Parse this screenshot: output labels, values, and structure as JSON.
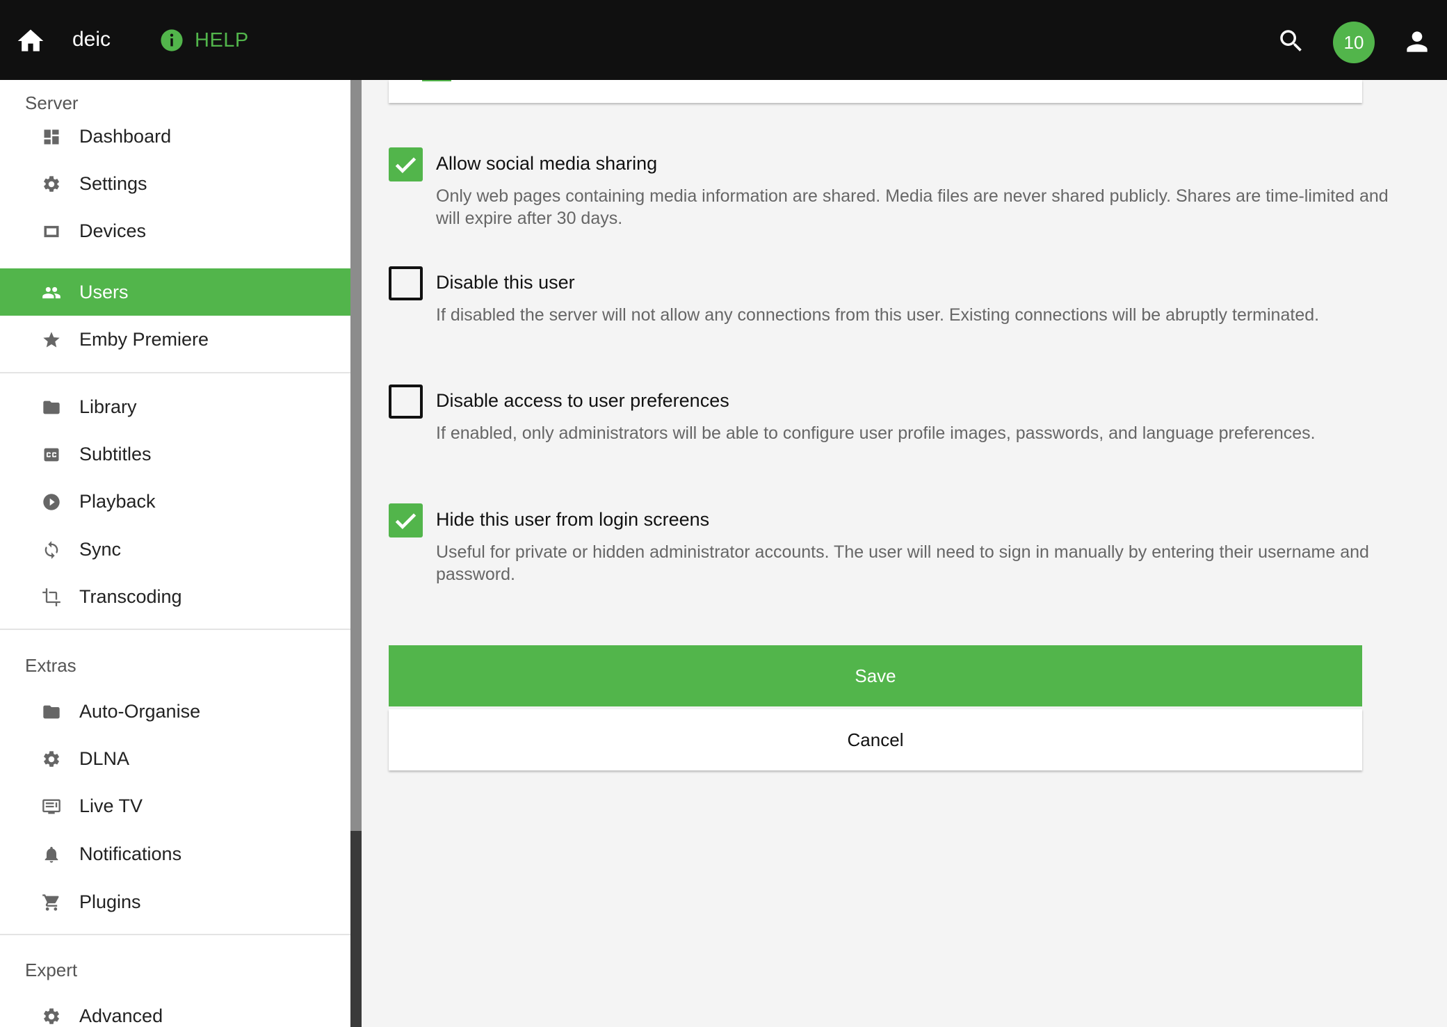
{
  "header": {
    "app_name": "deic",
    "help_label": "HELP",
    "notification_count": "10",
    "icons": [
      "home-icon",
      "info-icon",
      "search-icon",
      "account-icon"
    ]
  },
  "sidebar": {
    "sections": [
      {
        "title": "Server"
      },
      {
        "title": "Extras"
      },
      {
        "title": "Expert"
      }
    ],
    "items": [
      {
        "label": "Dashboard",
        "icon": "dashboard-icon"
      },
      {
        "label": "Settings",
        "icon": "gear-icon"
      },
      {
        "label": "Devices",
        "icon": "device-icon"
      },
      {
        "label": "Users",
        "icon": "users-icon",
        "active": true
      },
      {
        "label": "Emby Premiere",
        "icon": "star-icon"
      },
      {
        "label": "Library",
        "icon": "folder-icon"
      },
      {
        "label": "Subtitles",
        "icon": "closed-caption-icon"
      },
      {
        "label": "Playback",
        "icon": "play-circle-icon"
      },
      {
        "label": "Sync",
        "icon": "sync-icon"
      },
      {
        "label": "Transcoding",
        "icon": "crop-icon"
      },
      {
        "label": "Auto-Organise",
        "icon": "folder-icon"
      },
      {
        "label": "DLNA",
        "icon": "gear-icon"
      },
      {
        "label": "Live TV",
        "icon": "tv-icon"
      },
      {
        "label": "Notifications",
        "icon": "bell-icon"
      },
      {
        "label": "Plugins",
        "icon": "cart-icon"
      },
      {
        "label": "Advanced",
        "icon": "gear-icon"
      }
    ]
  },
  "options": [
    {
      "label": "Allow social media sharing",
      "description": "Only web pages containing media information are shared. Media files are never shared publicly. Shares are time-limited and will expire after 30 days.",
      "checked": true
    },
    {
      "label": "Disable this user",
      "description": "If disabled the server will not allow any connections from this user. Existing connections will be abruptly terminated.",
      "checked": false
    },
    {
      "label": "Disable access to user preferences",
      "description": "If enabled, only administrators will be able to configure user profile images, passwords, and language preferences.",
      "checked": false
    },
    {
      "label": "Hide this user from login screens",
      "description": "Useful for private or hidden administrator accounts. The user will need to sign in manually by entering their username and password.",
      "checked": true
    }
  ],
  "actions": {
    "save_label": "Save",
    "cancel_label": "Cancel"
  },
  "colors": {
    "accent": "#52b54b",
    "header_bg": "#101010",
    "page_bg": "#f4f4f4"
  }
}
